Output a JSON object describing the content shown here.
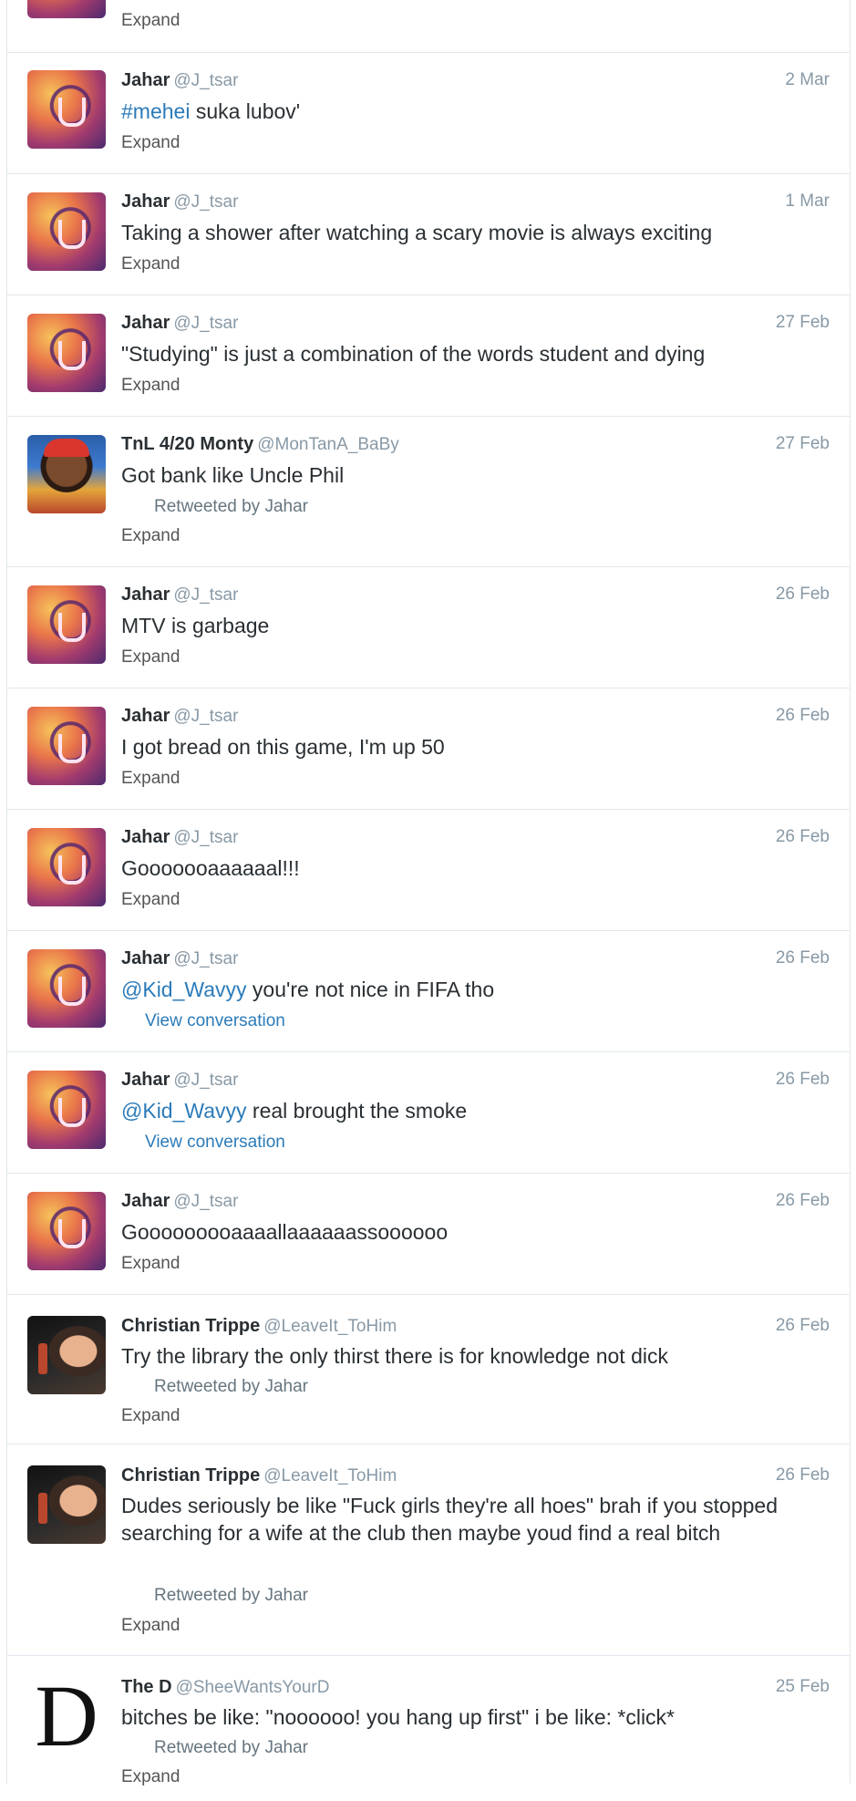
{
  "tweets": [
    {
      "expand": "Expand"
    },
    {
      "name": "Jahar",
      "handle": "@J_tsar",
      "time": "2 Mar",
      "hashtag": "#mehei",
      "text": " suka lubov'",
      "expand": "Expand"
    },
    {
      "name": "Jahar",
      "handle": "@J_tsar",
      "time": "1 Mar",
      "text": "Taking a shower after watching a scary movie is always exciting",
      "expand": "Expand"
    },
    {
      "name": "Jahar",
      "handle": "@J_tsar",
      "time": "27 Feb",
      "text": "\"Studying\" is just a combination of the words student and dying",
      "expand": "Expand"
    },
    {
      "name": "TnL 4/20 Monty",
      "handle": "@MonTanA_BaBy",
      "time": "27 Feb",
      "text": "Got bank like Uncle Phil",
      "retweet": "Retweeted by Jahar",
      "expand": "Expand"
    },
    {
      "name": "Jahar",
      "handle": "@J_tsar",
      "time": "26 Feb",
      "text": "MTV is garbage",
      "expand": "Expand"
    },
    {
      "name": "Jahar",
      "handle": "@J_tsar",
      "time": "26 Feb",
      "text": "I got bread on this game, I'm up 50",
      "expand": "Expand"
    },
    {
      "name": "Jahar",
      "handle": "@J_tsar",
      "time": "26 Feb",
      "text": "Gooooooaaaaaal!!!",
      "expand": "Expand"
    },
    {
      "name": "Jahar",
      "handle": "@J_tsar",
      "time": "26 Feb",
      "mention": "@Kid_Wavyy",
      "text": " you're not nice in FIFA tho",
      "view": "View conversation"
    },
    {
      "name": "Jahar",
      "handle": "@J_tsar",
      "time": "26 Feb",
      "mention": "@Kid_Wavyy",
      "text": " real brought the smoke",
      "view": "View conversation"
    },
    {
      "name": "Jahar",
      "handle": "@J_tsar",
      "time": "26 Feb",
      "text": "Gooooooooaaaallaaaaaassoooooo",
      "expand": "Expand"
    },
    {
      "name": "Christian Trippe",
      "handle": "@LeaveIt_ToHim",
      "time": "26 Feb",
      "text": "Try the library the only thirst there is for knowledge not dick",
      "retweet": "Retweeted by Jahar",
      "expand": "Expand"
    },
    {
      "name": "Christian Trippe",
      "handle": "@LeaveIt_ToHim",
      "time": "26 Feb",
      "text": "Dudes seriously be like \"Fuck girls they're all hoes\" brah if you stopped searching for a wife at the club then maybe youd find a real bitch",
      "retweet": "Retweeted by Jahar",
      "expand": "Expand"
    },
    {
      "name": "The D",
      "handle": "@SheeWantsYourD",
      "time": "25 Feb",
      "avatar_letter": "D",
      "text": "bitches be like: \"noooooo! you hang up first\" i be like: *click*",
      "retweet": "Retweeted by Jahar",
      "expand": "Expand"
    }
  ]
}
